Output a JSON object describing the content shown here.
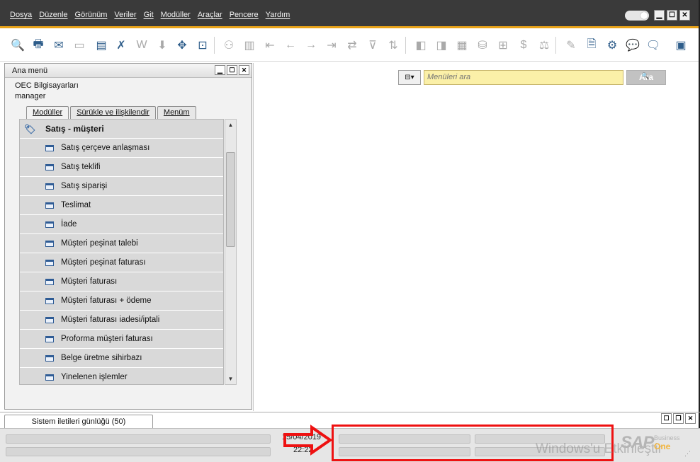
{
  "menubar": {
    "items": [
      "Dosya",
      "Düzenle",
      "Görünüm",
      "Veriler",
      "Git",
      "Modüller",
      "Araçlar",
      "Pencere",
      "Yardım"
    ],
    "window_controls": [
      "minimize-icon",
      "maximize-icon",
      "close-icon"
    ]
  },
  "toolbar": {
    "icons": [
      "print-preview-icon",
      "print-icon",
      "email-icon",
      "sms-icon",
      "fax-icon",
      "export-excel-icon",
      "export-word-icon",
      "export-pdf-icon",
      "launch-app-icon",
      "lock-screen-icon",
      "find-icon",
      "add-icon",
      "first-record-icon",
      "previous-record-icon",
      "next-record-icon",
      "last-record-icon",
      "refresh-icon",
      "filter-icon",
      "sort-icon",
      "base-document-icon",
      "target-document-icon",
      "layout-icon",
      "gross-profit-icon",
      "journal-entry-icon",
      "payment-means-icon",
      "volume-weight-icon",
      "form-settings-icon",
      "edit-icon",
      "document-settings-icon",
      "settings-wrench-icon",
      "messages-icon",
      "alerts-icon",
      "calendar-icon"
    ]
  },
  "ana_menu": {
    "title": "Ana menü",
    "company": "OEC Bilgisayarları",
    "user": "manager",
    "tabs": [
      "Modüller",
      "Sürükle ve ilişkilendir",
      "Menüm"
    ],
    "module_header": "Satış - müşteri",
    "module_icon": "sales-tag-icon",
    "items": [
      "Satış çerçeve anlaşması",
      "Satış teklifi",
      "Satış siparişi",
      "Teslimat",
      "İade",
      "Müşteri peşinat talebi",
      "Müşteri peşinat faturası",
      "Müşteri faturası",
      "Müşteri faturası + ödeme",
      "Müşteri faturası iadesi/iptali",
      "Proforma müşteri faturası",
      "Belge üretme sihirbazı",
      "Yinelenen işlemler"
    ]
  },
  "search": {
    "placeholder": "Menüleri ara",
    "button_label": "Ara"
  },
  "bottom": {
    "system_log_tab": "Sistem iletileri günlüğü (50)",
    "date": "15/04/2019",
    "time": "22:22"
  },
  "brand": {
    "sap": "SAP",
    "business": "Business",
    "one": "One"
  },
  "watermark": "Windows'u Etkinleştir",
  "colors": {
    "menubar_bg": "#3a3a3a",
    "accent": "#e9a318",
    "search_bg": "#fbf0a8",
    "highlight_red": "#e11111"
  }
}
